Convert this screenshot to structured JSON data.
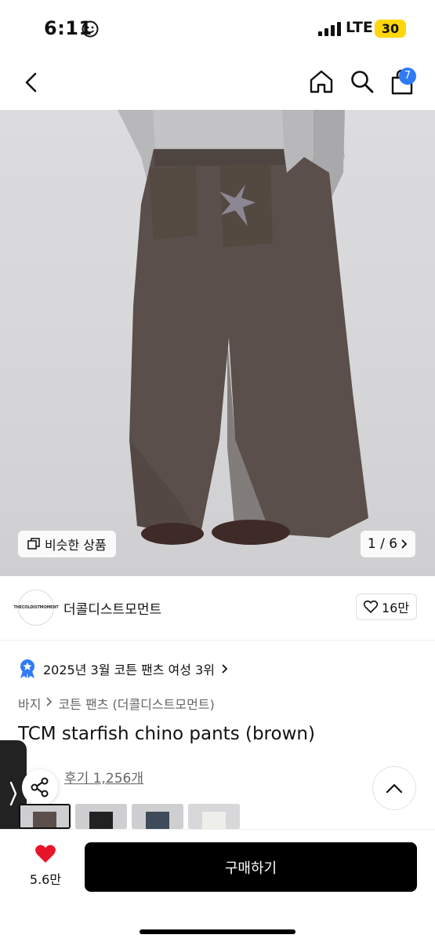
{
  "status_bar": {
    "time": "6:11",
    "network": "LTE",
    "battery": "30"
  },
  "nav": {
    "cart_count": "7"
  },
  "colors": {
    "accent": "#2f7bf6",
    "battery": "#ffd60a",
    "heart": "#e8142a",
    "buy_button": "#000000"
  },
  "gallery": {
    "similar_label": "비슷한 상품",
    "counter": "1 / 6"
  },
  "brand": {
    "logo_text": "THECOLDISTMOMENT",
    "name": "더콜디스트모먼트",
    "likes": "16만"
  },
  "ranking": {
    "text": "2025년 3월 코튼 팬츠 여성 3위"
  },
  "breadcrumb": {
    "category": "바지",
    "subcategory": "코튼 팬츠 (더콜디스트모먼트)"
  },
  "product": {
    "title": "TCM starfish chino pants (brown)",
    "reviews": "후기 1,256개"
  },
  "bottom": {
    "heart_count": "5.6만",
    "buy_label": "구매하기"
  },
  "icons": [
    "back-icon",
    "home-icon",
    "search-icon",
    "cart-icon",
    "similar-icon",
    "chevron-right-icon",
    "heart-outline-icon",
    "rank-badge-icon",
    "share-icon",
    "chevron-up-icon",
    "heart-filled-icon"
  ]
}
